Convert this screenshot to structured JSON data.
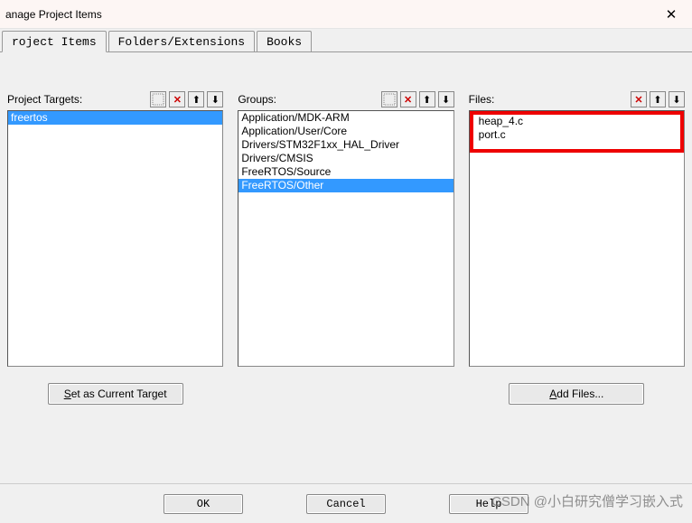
{
  "window": {
    "title": "anage Project Items"
  },
  "tabs": {
    "t0": "roject Items",
    "t1": "Folders/Extensions",
    "t2": "Books"
  },
  "cols": {
    "targets": {
      "label": "Project Targets:",
      "items": [
        "freertos"
      ],
      "selected_index": 0,
      "button": "Set as Current Target"
    },
    "groups": {
      "label": "Groups:",
      "items": [
        "Application/MDK-ARM",
        "Application/User/Core",
        "Drivers/STM32F1xx_HAL_Driver",
        "Drivers/CMSIS",
        "FreeRTOS/Source",
        "FreeRTOS/Other"
      ],
      "selected_index": 5
    },
    "files": {
      "label": "Files:",
      "items": [
        "heap_4.c",
        "port.c"
      ],
      "button": "Add Files..."
    }
  },
  "footer": {
    "ok": "OK",
    "cancel": "Cancel",
    "help": "Help"
  },
  "watermark": "CSDN @小白研究僧学习嵌入式",
  "toolbar_icons": {
    "new": "new-icon",
    "delete": "✕",
    "up": "⬆",
    "down": "⬇"
  }
}
